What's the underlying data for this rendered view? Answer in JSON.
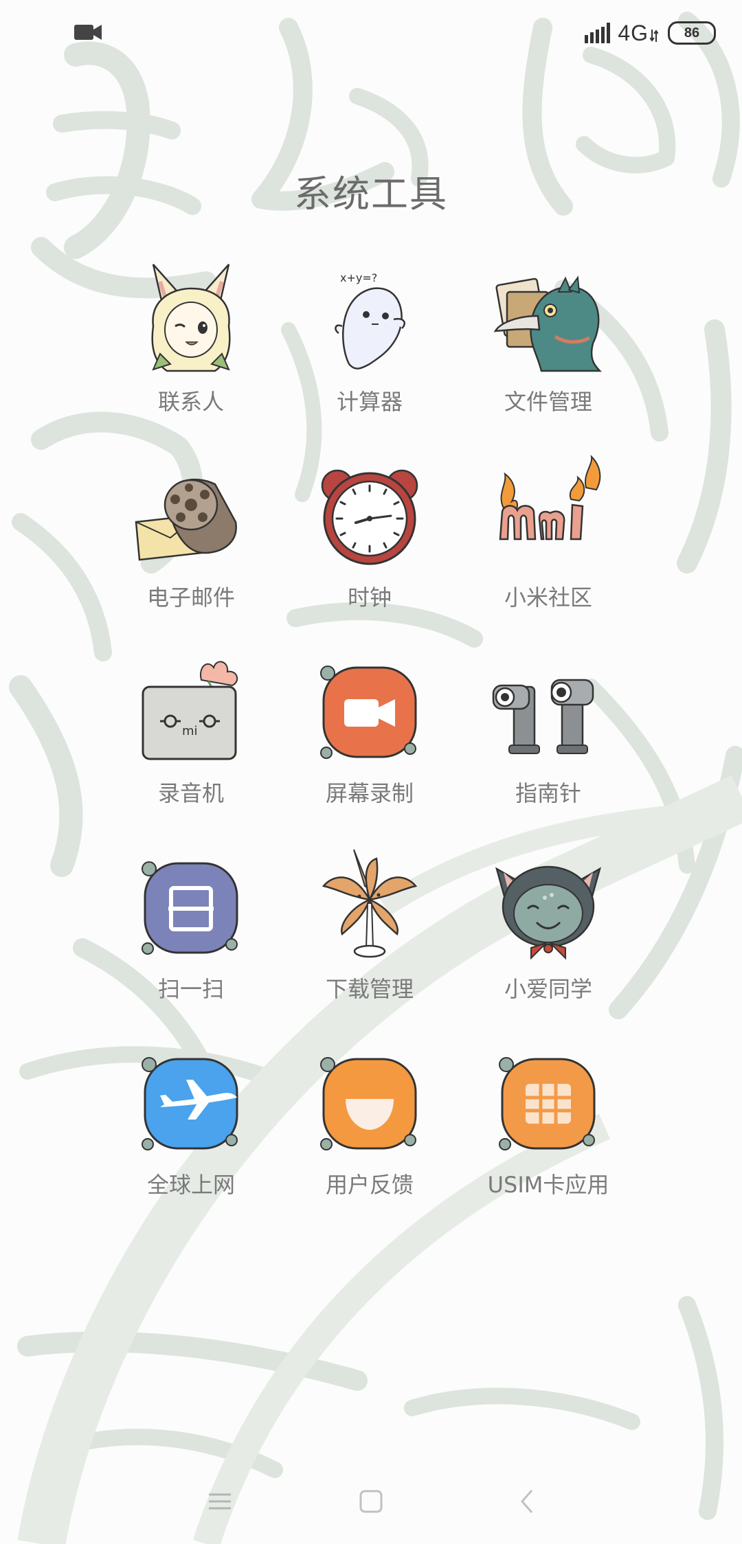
{
  "status_bar": {
    "network_type": "4G",
    "battery_level": "86",
    "left_icon": "video-camera-icon",
    "signal_icon": "signal-bars-icon"
  },
  "folder": {
    "title": "系统工具"
  },
  "apps": [
    {
      "label": "联系人",
      "icon": "contacts-fox-girl-icon"
    },
    {
      "label": "计算器",
      "icon": "calculator-ghost-icon"
    },
    {
      "label": "文件管理",
      "icon": "file-manager-bird-icon"
    },
    {
      "label": "电子邮件",
      "icon": "email-lotus-root-icon"
    },
    {
      "label": "时钟",
      "icon": "alarm-clock-icon"
    },
    {
      "label": "小米社区",
      "icon": "mi-community-flame-icon"
    },
    {
      "label": "录音机",
      "icon": "recorder-box-icon"
    },
    {
      "label": "屏幕录制",
      "icon": "screen-record-camera-icon"
    },
    {
      "label": "指南针",
      "icon": "compass-binoculars-icon"
    },
    {
      "label": "扫一扫",
      "icon": "scanner-icon"
    },
    {
      "label": "下载管理",
      "icon": "download-flower-icon"
    },
    {
      "label": "小爱同学",
      "icon": "xiaoai-cat-icon"
    },
    {
      "label": "全球上网",
      "icon": "global-internet-plane-icon"
    },
    {
      "label": "用户反馈",
      "icon": "feedback-smile-icon"
    },
    {
      "label": "USIM卡应用",
      "icon": "usim-card-icon"
    }
  ],
  "colors": {
    "background": "#fbfcfb",
    "label_text": "#7a7a7a",
    "title_text": "#6b6b6b",
    "screen_record_orange": "#e8734a",
    "scanner_purple": "#7c83b8",
    "global_blue": "#4aa3ec",
    "feedback_orange": "#f4993f",
    "usim_orange": "#f39a48"
  },
  "nav_bar": {
    "menu_icon": "menu-lines-icon",
    "home_icon": "home-square-icon",
    "back_icon": "back-chevron-icon"
  }
}
